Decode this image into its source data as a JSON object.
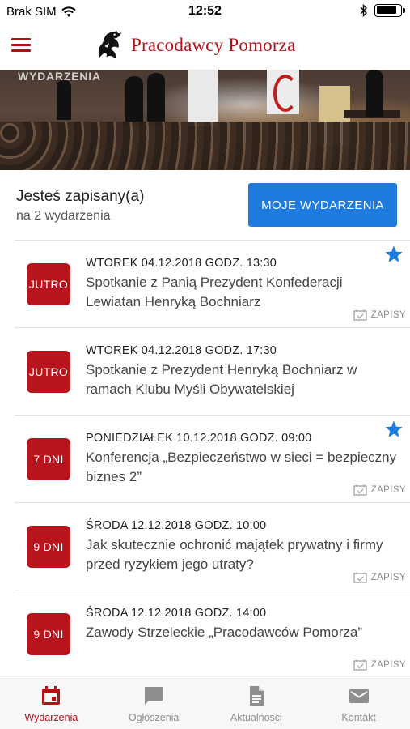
{
  "status_bar": {
    "carrier": "Brak SIM",
    "time": "12:52"
  },
  "header": {
    "logo_text": "Pracodawcy Pomorza",
    "brand_color": "#b01216"
  },
  "hero": {
    "label": "WYDARZENIA"
  },
  "summary": {
    "title": "Jesteś zapisany(a)",
    "subtitle": "na 2 wydarzenia",
    "button_label": "MOJE WYDARZENIA",
    "button_color": "#1e7be0"
  },
  "events": [
    {
      "badge": "JUTRO",
      "date": "WTOREK 04.12.2018 GODZ. 13:30",
      "title": "Spotkanie z Panią Prezydent Konfederacji Lewiatan Henryką Bochniarz",
      "starred": true,
      "register_label": "ZAPISY"
    },
    {
      "badge": "JUTRO",
      "date": "WTOREK 04.12.2018 GODZ. 17:30",
      "title": "Spotkanie z Prezydent Henryką Bochniarz w ramach Klubu Myśli Obywatelskiej",
      "starred": false,
      "register_label": ""
    },
    {
      "badge": "7 DNI",
      "date": "PONIEDZIAŁEK 10.12.2018 GODZ. 09:00",
      "title": "Konferencja „Bezpieczeństwo w sieci = bezpieczny biznes 2”",
      "starred": true,
      "register_label": "ZAPISY"
    },
    {
      "badge": "9 DNI",
      "date": "ŚRODA 12.12.2018 GODZ. 10:00",
      "title": "Jak skutecznie ochronić majątek prywatny i firmy przed ryzykiem jego utraty?",
      "starred": false,
      "register_label": "ZAPISY"
    },
    {
      "badge": "9 DNI",
      "date": "ŚRODA 12.12.2018 GODZ. 14:00",
      "title": "Zawody Strzeleckie „Pracodawców Pomorza”",
      "starred": false,
      "register_label": "ZAPISY"
    }
  ],
  "tabs": [
    {
      "label": "Wydarzenia",
      "icon": "calendar-icon",
      "active": true
    },
    {
      "label": "Ogłoszenia",
      "icon": "chat-bubble-icon",
      "active": false
    },
    {
      "label": "Aktualności",
      "icon": "document-icon",
      "active": false
    },
    {
      "label": "Kontakt",
      "icon": "envelope-icon",
      "active": false
    }
  ],
  "colors": {
    "badge": "#b8141b",
    "star": "#1e7be0",
    "tab_active": "#b01216",
    "tab_inactive": "#8e8e8e"
  }
}
